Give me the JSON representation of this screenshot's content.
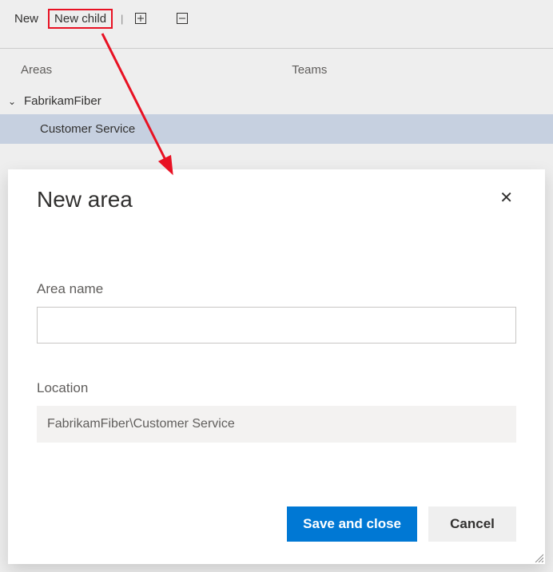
{
  "toolbar": {
    "new_label": "New",
    "new_child_label": "New child"
  },
  "tabs": {
    "areas_label": "Areas",
    "teams_label": "Teams"
  },
  "tree": {
    "parent_label": "FabrikamFiber",
    "child_label": "Customer Service"
  },
  "dialog": {
    "title": "New area",
    "area_name_label": "Area name",
    "area_name_value": "",
    "location_label": "Location",
    "location_value": "FabrikamFiber\\Customer Service",
    "save_label": "Save and close",
    "cancel_label": "Cancel"
  },
  "colors": {
    "primary": "#0078d4",
    "highlight": "#e81123"
  }
}
